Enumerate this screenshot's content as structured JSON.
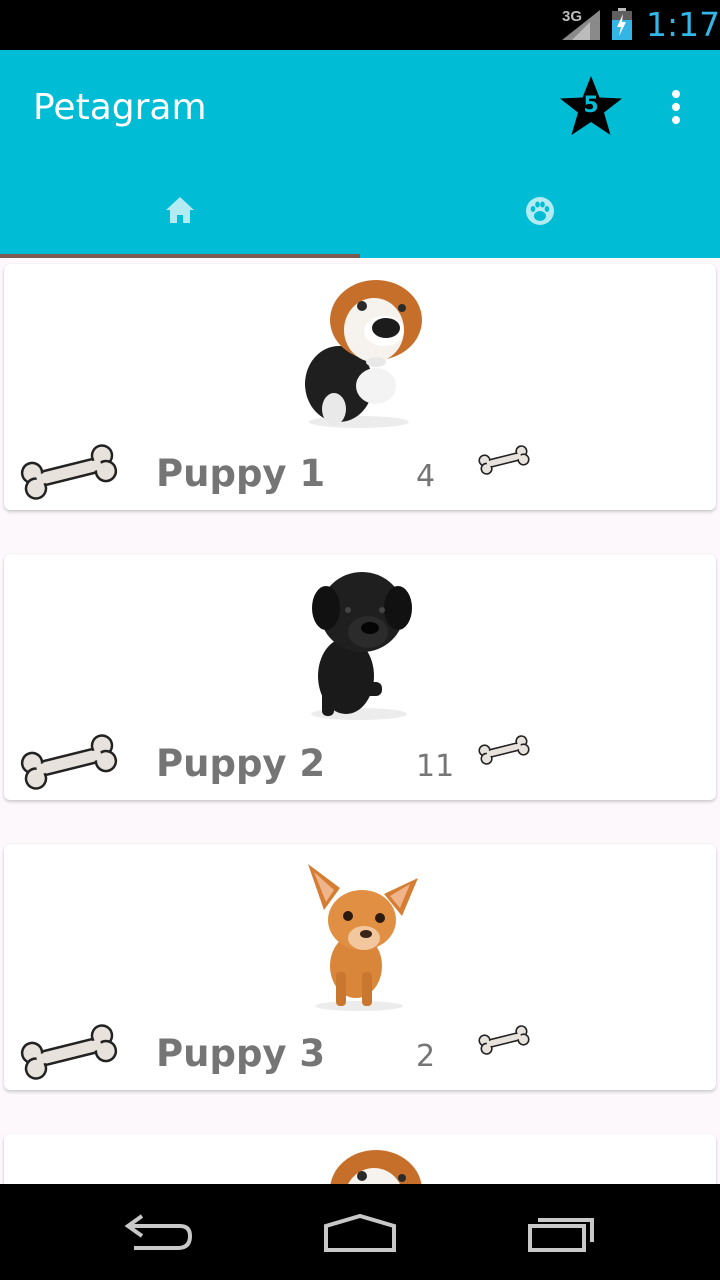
{
  "status_bar": {
    "network": "3G",
    "time": "1:17",
    "signal_icon": "signal-icon",
    "battery_icon": "battery-charging-icon"
  },
  "app_bar": {
    "title": "Petagram",
    "favorites_icon": "star-icon",
    "favorites_count": "5",
    "menu_icon": "more-vert-icon",
    "background_color": "#00bcd4"
  },
  "tabs": [
    {
      "icon": "home-icon",
      "selected": true
    },
    {
      "icon": "paw-icon",
      "selected": false
    }
  ],
  "tab_indicator_color": "#7d5a50",
  "pets": [
    {
      "name": "Puppy 1",
      "likes": "4",
      "image": "beagle-puppy-image"
    },
    {
      "name": "Puppy 2",
      "likes": "11",
      "image": "black-puppy-image"
    },
    {
      "name": "Puppy 3",
      "likes": "2",
      "image": "chihuahua-puppy-image"
    },
    {
      "name": "",
      "likes": "",
      "image": "beagle-puppy-image"
    }
  ],
  "nav_bar": {
    "back_icon": "back-icon",
    "home_icon": "home-outline-icon",
    "recents_icon": "recents-icon"
  }
}
